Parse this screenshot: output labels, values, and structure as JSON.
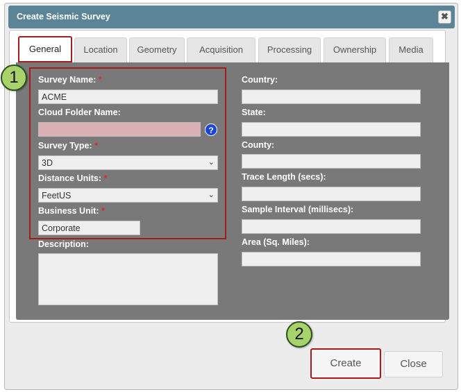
{
  "dialog": {
    "title": "Create Seismic Survey",
    "close_glyph": "✖"
  },
  "tabs": [
    {
      "label": "General",
      "active": true
    },
    {
      "label": "Location",
      "active": false
    },
    {
      "label": "Geometry",
      "active": false
    },
    {
      "label": "Acquisition",
      "active": false
    },
    {
      "label": "Processing",
      "active": false
    },
    {
      "label": "Ownership",
      "active": false
    },
    {
      "label": "Media",
      "active": false
    }
  ],
  "left_fields": {
    "survey_name": {
      "label": "Survey Name:",
      "required": "*",
      "value": "ACME"
    },
    "cloud_folder": {
      "label": "Cloud Folder Name:",
      "value": "",
      "help": "?"
    },
    "survey_type": {
      "label": "Survey Type:",
      "required": "*",
      "value": "3D"
    },
    "distance_units": {
      "label": "Distance Units:",
      "required": "*",
      "value": "FeetUS"
    },
    "business_unit": {
      "label": "Business Unit:",
      "required": "*",
      "value": "Corporate"
    },
    "description": {
      "label": "Description:",
      "value": ""
    }
  },
  "right_fields": {
    "country": {
      "label": "Country:",
      "value": ""
    },
    "state": {
      "label": "State:",
      "value": ""
    },
    "county": {
      "label": "County:",
      "value": ""
    },
    "trace_length": {
      "label": "Trace Length (secs):",
      "value": ""
    },
    "sample_interval": {
      "label": "Sample Interval (millisecs):",
      "value": ""
    },
    "area": {
      "label": "Area (Sq. Miles):",
      "value": ""
    }
  },
  "callouts": {
    "one": "1",
    "two": "2"
  },
  "buttons": {
    "create": "Create",
    "close": "Close"
  },
  "icons": {
    "chevron": "chevron-down-icon",
    "help": "help-icon",
    "close": "close-icon"
  },
  "colors": {
    "titlebar": "#5b8497",
    "panel": "#797979",
    "highlight": "#a31b1b",
    "required": "#e02a2a",
    "callout": "#a8d26a",
    "help": "#1a44e0"
  }
}
